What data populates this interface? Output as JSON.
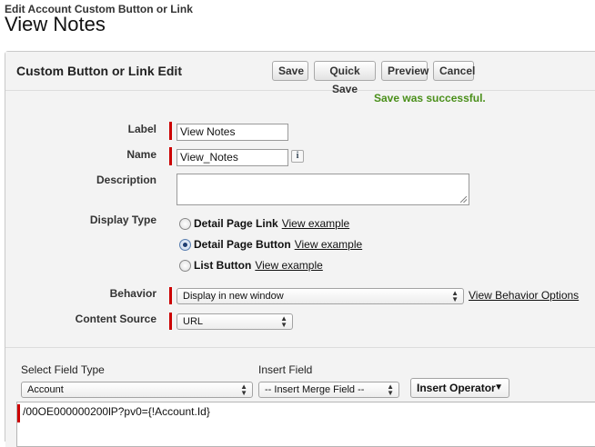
{
  "breadcrumb": "Edit Account Custom Button or Link",
  "page_title": "View Notes",
  "panel": {
    "title": "Custom Button or Link Edit",
    "buttons": {
      "save": "Save",
      "quick_save": "Quick Save",
      "preview": "Preview",
      "cancel": "Cancel"
    },
    "success_message": "Save was successful."
  },
  "form": {
    "label": {
      "caption": "Label",
      "value": "View Notes"
    },
    "name": {
      "caption": "Name",
      "value": "View_Notes",
      "info_icon": "i"
    },
    "description": {
      "caption": "Description",
      "value": ""
    },
    "display_type": {
      "caption": "Display Type",
      "options": [
        {
          "label": "Detail Page Link",
          "link": "View example",
          "checked": false
        },
        {
          "label": "Detail Page Button",
          "link": "View example",
          "checked": true
        },
        {
          "label": "List Button",
          "link": "View example",
          "checked": false
        }
      ]
    },
    "behavior": {
      "caption": "Behavior",
      "value": "Display in new window",
      "link": "View Behavior Options"
    },
    "content_source": {
      "caption": "Content Source",
      "value": "URL"
    }
  },
  "insert": {
    "field_type_label": "Select Field Type",
    "field_type_value": "Account",
    "insert_field_label": "Insert Field",
    "insert_field_value": "-- Insert Merge Field --",
    "insert_operator": "Insert Operator"
  },
  "formula": "/00OE000000200lP?pv0={!Account.Id}",
  "colors": {
    "required": "#cc0000",
    "success": "#4a8f1a"
  }
}
